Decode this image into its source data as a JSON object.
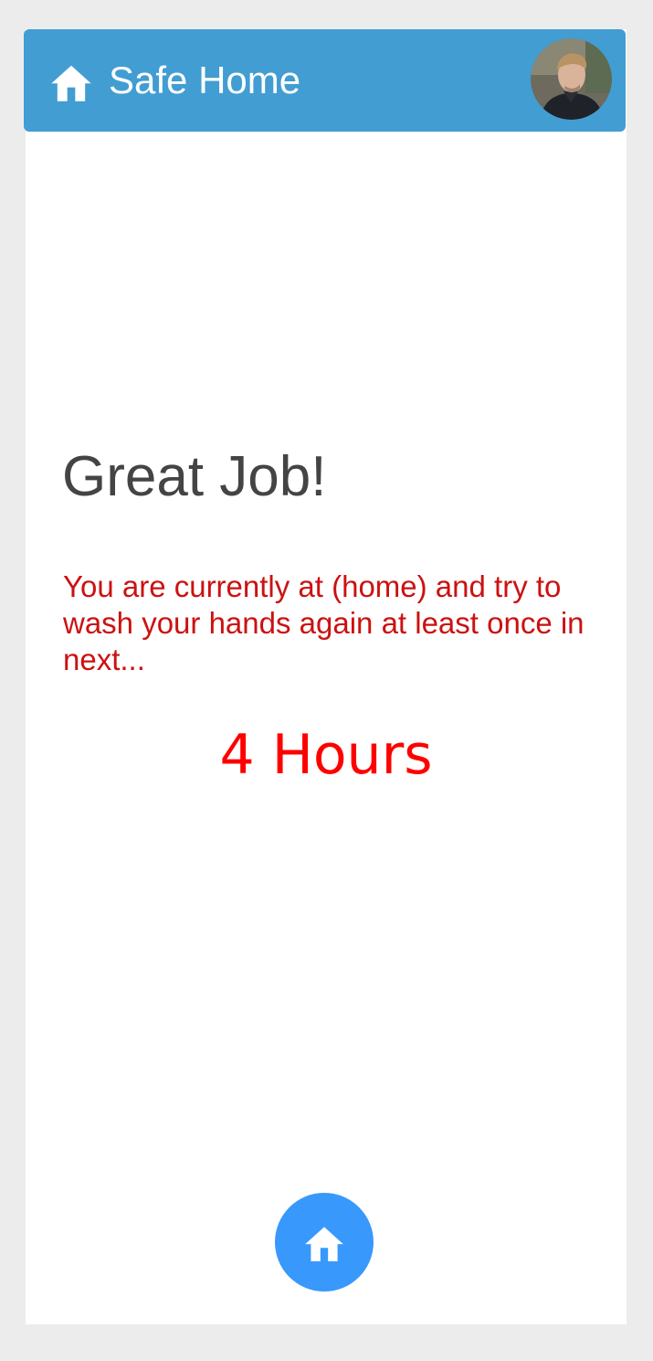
{
  "header": {
    "title": "Safe Home",
    "icon": "home-icon",
    "background_color": "#429dd2",
    "avatar": "user-avatar"
  },
  "main": {
    "heading": "Great Job!",
    "message": "You are currently at (home) and try to wash your hands again at least once in next...",
    "countdown": "4 Hours",
    "message_color": "#cc1111",
    "countdown_color": "#ff0000"
  },
  "fab": {
    "icon": "home-icon",
    "color": "#3898fc"
  }
}
